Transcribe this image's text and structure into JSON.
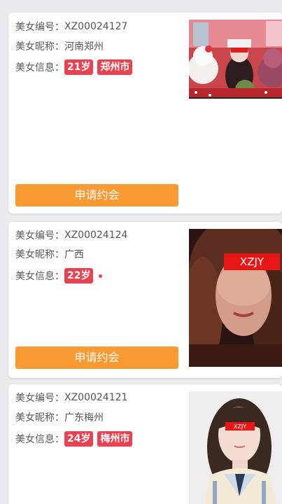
{
  "labels": {
    "id": "美女编号：",
    "nickname": "美女昵称：",
    "info": "美女信息："
  },
  "apply_label": "申请约会",
  "cards": [
    {
      "id": "XZ00024127",
      "nickname": "河南郑州",
      "age": "21岁",
      "city": "郑州市"
    },
    {
      "id": "XZ00024124",
      "nickname": "广西",
      "age": "22岁",
      "city": ""
    },
    {
      "id": "XZ00024121",
      "nickname": "广东梅州",
      "age": "24岁",
      "city": "梅州市"
    }
  ],
  "photo_censor_text": [
    "XZJY",
    "XZJY"
  ],
  "colors": {
    "accent_button": "#f99a33",
    "tag": "#e8414f",
    "background": "#ebebef"
  }
}
